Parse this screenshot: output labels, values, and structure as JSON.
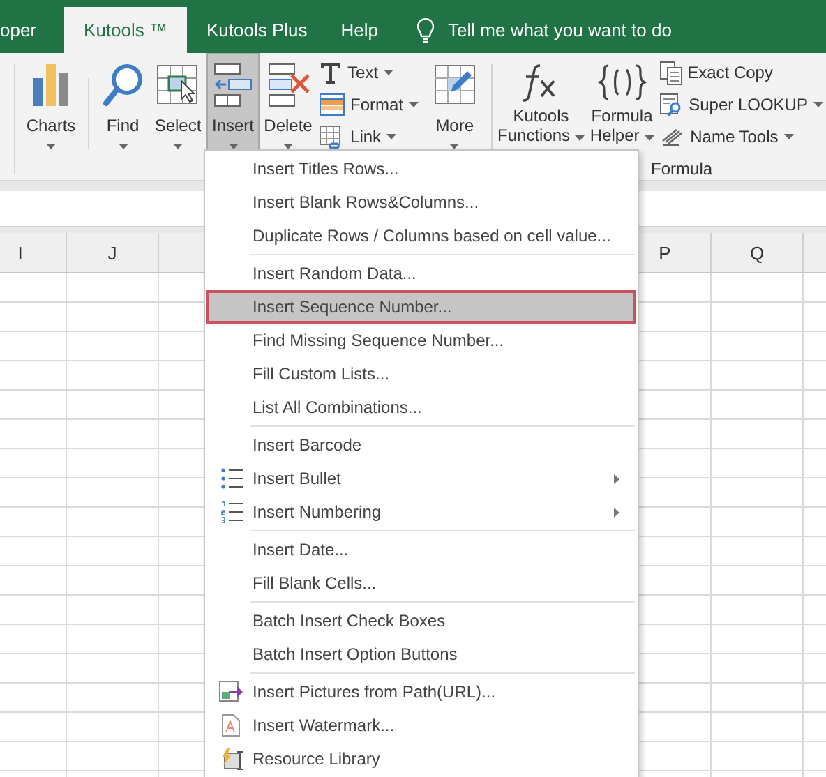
{
  "tabs": [
    {
      "label": "oper",
      "selected": false
    },
    {
      "label": "Kutools ™",
      "selected": true
    },
    {
      "label": "Kutools Plus",
      "selected": false
    },
    {
      "label": "Help",
      "selected": false
    }
  ],
  "tell_me": "Tell me what you want to do",
  "ribbon": {
    "left_buttons": [
      {
        "kind": "charts",
        "label": "Charts",
        "pressed": false
      },
      {
        "kind": "find",
        "label": "Find",
        "pressed": false
      },
      {
        "kind": "select",
        "label": "Select",
        "pressed": false
      },
      {
        "kind": "insert",
        "label": "Insert",
        "pressed": true
      },
      {
        "kind": "delete",
        "label": "Delete",
        "pressed": false
      }
    ],
    "small_buttons": [
      {
        "kind": "text",
        "label": "Text"
      },
      {
        "kind": "format",
        "label": "Format"
      },
      {
        "kind": "link",
        "label": "Link"
      }
    ],
    "more_button": {
      "label": "More"
    },
    "formula_group": {
      "label": "Formula",
      "buttons": [
        {
          "kind": "fx",
          "label": "Kutools",
          "label2": "Functions"
        },
        {
          "kind": "braces",
          "label": "Formula",
          "label2": "Helper"
        }
      ],
      "small_buttons": [
        {
          "kind": "copy",
          "label": "Exact Copy",
          "dropdown": false
        },
        {
          "kind": "lookup",
          "label": "Super LOOKUP",
          "dropdown": true
        },
        {
          "kind": "names",
          "label": "Name Tools",
          "dropdown": true
        }
      ]
    }
  },
  "columns_left": [
    "I",
    "J"
  ],
  "columns_right": [
    "P",
    "Q"
  ],
  "menu": {
    "groups": [
      [
        {
          "kind": "plain",
          "label": "Insert Titles Rows...",
          "selected": false,
          "submenu": false
        },
        {
          "kind": "plain",
          "label": "Insert Blank Rows&Columns...",
          "selected": false,
          "submenu": false
        },
        {
          "kind": "plain",
          "label": "Duplicate Rows / Columns based on cell value...",
          "selected": false,
          "submenu": false
        }
      ],
      [
        {
          "kind": "plain",
          "label": "Insert Random Data...",
          "selected": false,
          "submenu": false
        },
        {
          "kind": "plain",
          "label": "Insert Sequence Number...",
          "selected": true,
          "submenu": false
        },
        {
          "kind": "plain",
          "label": "Find Missing Sequence Number...",
          "selected": false,
          "submenu": false
        },
        {
          "kind": "plain",
          "label": "Fill Custom Lists...",
          "selected": false,
          "submenu": false
        },
        {
          "kind": "plain",
          "label": "List All Combinations...",
          "selected": false,
          "submenu": false
        }
      ],
      [
        {
          "kind": "plain",
          "label": "Insert Barcode",
          "selected": false,
          "submenu": false
        },
        {
          "kind": "bullet",
          "label": "Insert Bullet",
          "selected": false,
          "submenu": true
        },
        {
          "kind": "numbering",
          "label": "Insert Numbering",
          "selected": false,
          "submenu": true
        }
      ],
      [
        {
          "kind": "plain",
          "label": "Insert Date...",
          "selected": false,
          "submenu": false
        },
        {
          "kind": "plain",
          "label": "Fill Blank Cells...",
          "selected": false,
          "submenu": false
        }
      ],
      [
        {
          "kind": "plain",
          "label": "Batch Insert Check Boxes",
          "selected": false,
          "submenu": false
        },
        {
          "kind": "plain",
          "label": "Batch Insert Option Buttons",
          "selected": false,
          "submenu": false
        }
      ],
      [
        {
          "kind": "pictures",
          "label": "Insert Pictures from Path(URL)...",
          "selected": false,
          "submenu": false
        },
        {
          "kind": "watermark",
          "label": "Insert Watermark...",
          "selected": false,
          "submenu": false
        },
        {
          "kind": "library",
          "label": "Resource Library",
          "selected": false,
          "submenu": false
        }
      ]
    ]
  }
}
